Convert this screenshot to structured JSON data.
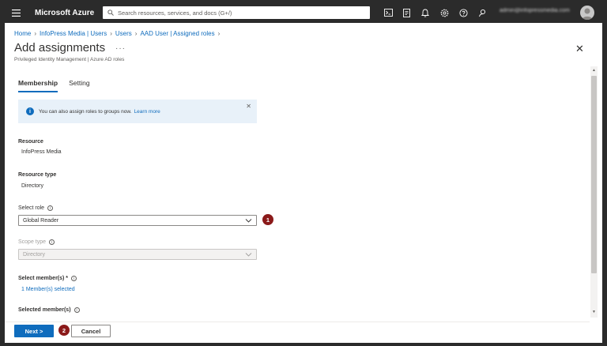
{
  "topbar": {
    "brand": "Microsoft Azure",
    "search_placeholder": "Search resources, services, and docs (G+/)",
    "account_label": "admin@infopressmedia.com",
    "icons": [
      "menu-icon",
      "search-icon",
      "cloud-shell-icon",
      "directory-filter-icon",
      "notifications-icon",
      "settings-icon",
      "help-icon",
      "feedback-icon",
      "avatar-icon"
    ]
  },
  "breadcrumb": [
    "Home",
    "InfoPress Media | Users",
    "Users",
    "AAD User | Assigned roles"
  ],
  "header": {
    "title": "Add assignments",
    "more": "···",
    "subtitle": "Privileged Identity Management | Azure AD roles",
    "close": "✕"
  },
  "tabs": [
    {
      "label": "Membership",
      "active": true
    },
    {
      "label": "Setting",
      "active": false
    }
  ],
  "info_banner": {
    "text": "You can also assign roles to groups now.",
    "link": "Learn more",
    "close": "✕"
  },
  "form": {
    "resource_label": "Resource",
    "resource_value": "InfoPress Media",
    "resource_type_label": "Resource type",
    "resource_type_value": "Directory",
    "select_role_label": "Select role",
    "select_role_value": "Global Reader",
    "scope_type_label": "Scope type",
    "scope_type_value": "Directory",
    "select_members_label": "Select member(s) *",
    "select_members_value": "1 Member(s) selected",
    "selected_members_label": "Selected member(s)"
  },
  "steps": [
    "1",
    "2"
  ],
  "footer": {
    "next_label": "Next >",
    "cancel_label": "Cancel"
  },
  "colors": {
    "accent": "#0f6cbd",
    "topbar": "#2b2b2b",
    "step_marker": "#8b1a1a",
    "info_background": "#e8f1f9"
  }
}
